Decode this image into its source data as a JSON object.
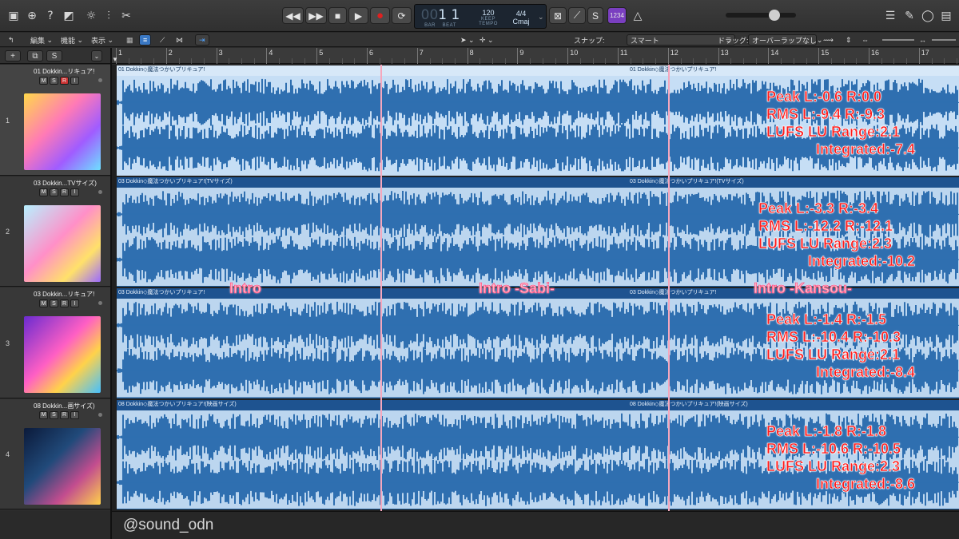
{
  "toolbar": {
    "left_icons": [
      "inbox-icon",
      "download-icon",
      "help-icon",
      "smart-controls-icon",
      "brightness-icon",
      "mixer-icon",
      "scissors-icon"
    ],
    "transport": [
      "rewind",
      "fast-forward",
      "stop",
      "play",
      "record",
      "cycle"
    ],
    "lcd": {
      "bar": "1",
      "beat": "1",
      "bar_prefix": "00",
      "bar_label": "BAR",
      "beat_label": "BEAT",
      "tempo": "120",
      "tempo_sub": "KEEP",
      "tempo_label": "TEMPO",
      "signature": "4/4",
      "key": "Cmaj"
    },
    "mid_icons": [
      "replace-icon",
      "tuner-icon",
      "solo-icon"
    ],
    "count_in": "1234",
    "right_icons": [
      "list-icon",
      "notepad-icon",
      "loops-icon",
      "browser-icon"
    ],
    "colors": {
      "accent": "#7a3fc0",
      "record": "#e02020"
    }
  },
  "editbar": {
    "back": "↰",
    "edit": "編集",
    "function": "機能",
    "view": "表示",
    "snap_label": "スナップ:",
    "snap_value": "スマート",
    "drag_label": "ドラッグ:",
    "drag_value": "オーバーラップなし"
  },
  "header": {
    "add": "+",
    "dup": "⧉",
    "s": "S"
  },
  "ruler": {
    "ticks": [
      "1",
      "2",
      "3",
      "4",
      "5",
      "6",
      "7",
      "8",
      "9",
      "10",
      "11",
      "12",
      "13",
      "14",
      "15",
      "16",
      "17"
    ]
  },
  "tracks": [
    {
      "num": "1",
      "name": "01 Dokkin...リキュア!",
      "m": "M",
      "s": "S",
      "r": "R",
      "i": "I",
      "region_title": "01 Dokkin◇魔法つかいプリキュア!",
      "region_title2": "01 Dokkin◇魔法つかいプリキュア!",
      "stats": {
        "peak": "Peak L:-0.6 R:0.0",
        "rms": "RMS L:-9.4 R:-9.3",
        "lufs": "LUFS  LU Range:2.1",
        "integrated": "Integrated:-7.4"
      }
    },
    {
      "num": "2",
      "name": "03 Dokkin...TVサイズ)",
      "m": "M",
      "s": "S",
      "r": "R",
      "i": "I",
      "region_title": "03 Dokkin◇魔法つかいプリキュア!(TVサイズ)",
      "region_title2": "03 Dokkin◇魔法つかいプリキュア!(TVサイズ)",
      "stats": {
        "peak": "Peak L:-3.3 R:-3.4",
        "rms": "RMS L:-12.2 R:-12.1",
        "lufs": "LUFS  LU Range:2.3",
        "integrated": "Integrated:-10.2"
      }
    },
    {
      "num": "3",
      "name": "03 Dokkin...リキュア!",
      "m": "M",
      "s": "S",
      "r": "R",
      "i": "I",
      "region_title": "03 Dokkin◇魔法つかいプリキュア!",
      "region_title2": "03 Dokkin◇魔法つかいプリキュア!",
      "stats": {
        "peak": "Peak L:-1.4 R:-1.5",
        "rms": "RMS L:-10.4 R:-10.3",
        "lufs": "LUFS  LU Range:2.1",
        "integrated": "Integrated:-8.4"
      }
    },
    {
      "num": "4",
      "name": "08 Dokkin...画サイズ)",
      "m": "M",
      "s": "S",
      "r": "R",
      "i": "I",
      "region_title": "08 Dokkin◇魔法つかいプリキュア!(映画サイズ)",
      "region_title2": "08 Dokkin◇魔法つかいプリキュア!(映画サイズ)",
      "stats": {
        "peak": "Peak L:-1.8 R:-1.8",
        "rms": "RMS L:-10.6 R:-10.5",
        "lufs": "LUFS  LU Range:2.3",
        "integrated": "Integrated:-8.6"
      }
    }
  ],
  "sections": {
    "intro": "Intro",
    "sabi": "Intro -Sabi-",
    "kansou": "Intro -Kansou-"
  },
  "credit": "@sound_odn",
  "colors": {
    "waveform": "#2f6fb0",
    "region_selected": "#c6def5",
    "region_bg": "#bcd6ef",
    "marker": "#f5a7bd",
    "stats_text": "#ff1a1a"
  }
}
